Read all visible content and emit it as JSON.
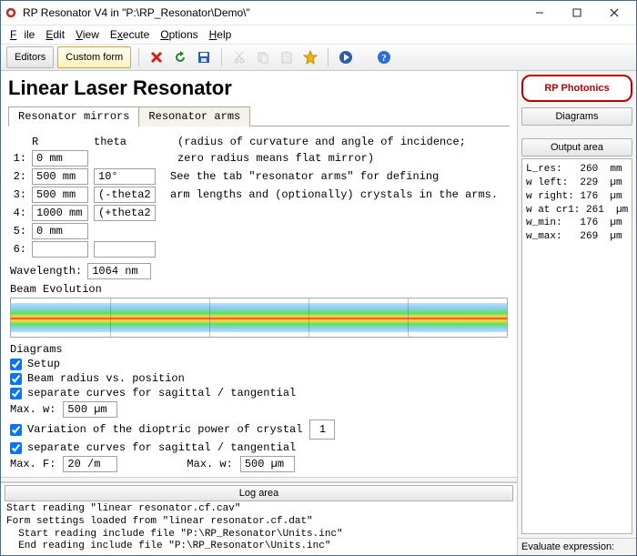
{
  "window": {
    "title": "RP Resonator V4 in \"P:\\RP_Resonator\\Demo\\\""
  },
  "menu": {
    "file": "File",
    "edit": "Edit",
    "view": "View",
    "execute": "Execute",
    "options": "Options",
    "help": "Help"
  },
  "toolbar": {
    "editors": "Editors",
    "custom": "Custom form"
  },
  "page": {
    "title": "Linear Laser Resonator"
  },
  "tabs": {
    "mirrors": "Resonator mirrors",
    "arms": "Resonator arms"
  },
  "headers": {
    "R": "R",
    "theta": "theta",
    "desc1": "(radius of curvature and angle of incidence;",
    "desc2": " zero radius means flat mirror)",
    "desc3": "See the tab \"resonator arms\" for defining",
    "desc4": "arm lengths and (optionally) crystals in the arms."
  },
  "rows": [
    {
      "n": "1:",
      "R": "0 mm",
      "theta": ""
    },
    {
      "n": "2:",
      "R": "500 mm",
      "theta": "10°"
    },
    {
      "n": "3:",
      "R": "500 mm",
      "theta": "(-theta2"
    },
    {
      "n": "4:",
      "R": "1000 mm",
      "theta": "(+theta2"
    },
    {
      "n": "5:",
      "R": "0 mm",
      "theta": ""
    },
    {
      "n": "6:",
      "R": "",
      "theta": ""
    }
  ],
  "wavelength": {
    "label": "Wavelength:",
    "value": "1064 nm"
  },
  "beam": {
    "label": "Beam Evolution"
  },
  "diag": {
    "label": "Diagrams",
    "setup": "Setup",
    "radius": "Beam radius vs. position",
    "sep1": "separate curves for sagittal / tangential",
    "maxw": "Max. w:",
    "maxw_v": "500 µm",
    "varpow": "Variation of the dioptric power of crystal",
    "varpow_n": "1",
    "sep2": "separate curves for sagittal / tangential",
    "maxF": "Max. F:",
    "maxF_v": "20 /m",
    "maxw2": "Max. w:",
    "maxw2_v": "500 µm"
  },
  "logarea": {
    "title": "Log area",
    "lines": "Start reading \"linear resonator.cf.cav\"\nForm settings loaded from \"linear resonator.cf.dat\"\n  Start reading include file \"P:\\RP_Resonator\\Units.inc\"\n  End reading include file \"P:\\RP_Resonator\\Units.inc\""
  },
  "side": {
    "logo": "RP Photonics",
    "diagrams": "Diagrams",
    "outputarea": "Output area",
    "output": "L_res:   260  mm\nw left:  229  µm\nw right: 176  µm\nw at cr1: 261  µm\nw_min:   176  µm\nw_max:   269  µm",
    "eval": "Evaluate expression:"
  }
}
